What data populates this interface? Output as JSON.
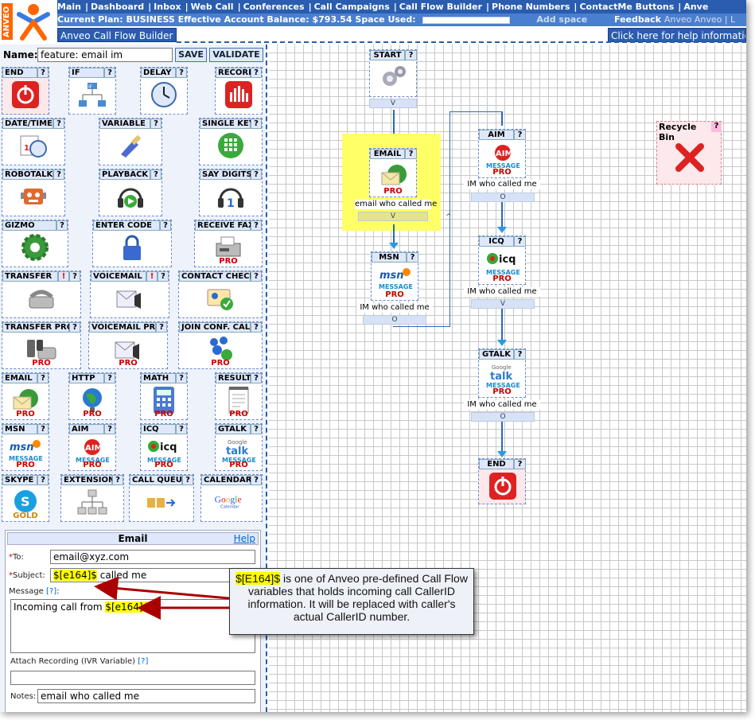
{
  "app": {
    "title": "Anveo Call Flow Builder",
    "help_link": "Click here for help information"
  },
  "logo": {
    "brand": "ANVEO"
  },
  "nav": {
    "items": [
      "Main",
      "Dashboard",
      "Inbox",
      "Web Call",
      "Conferences",
      "Call Campaigns",
      "Call Flow Builder",
      "Phone Numbers",
      "ContactMe Buttons",
      "Anve"
    ]
  },
  "plan": {
    "text": "Current Plan: BUSINESS Effective Account Balance: $793.54 Space Used:",
    "add_space": "Add space",
    "feedback": "Feedback",
    "feedback_suffix": "Anveo Anveo | L"
  },
  "editor": {
    "name_label": "Name:",
    "name_value": "feature: email im",
    "save_label": "SAVE",
    "validate_label": "VALIDATE"
  },
  "palette": [
    {
      "label": "END",
      "icon": "power-icon",
      "pro": ""
    },
    {
      "label": "IF",
      "icon": "if-tree-icon",
      "pro": ""
    },
    {
      "label": "DELAY",
      "icon": "clock-icon",
      "pro": ""
    },
    {
      "label": "RECORD",
      "icon": "record-icon",
      "pro": ""
    },
    {
      "label": "DATE/TIME",
      "icon": "calendar-clock-icon",
      "pro": ""
    },
    {
      "label": "VARIABLE",
      "icon": "brush-icon",
      "pro": ""
    },
    {
      "label": "SINGLE KEY",
      "icon": "keypad-icon",
      "pro": ""
    },
    {
      "label": "ROBOTALK",
      "icon": "robot-icon",
      "pro": ""
    },
    {
      "label": "PLAYBACK",
      "icon": "play-headphones-icon",
      "pro": ""
    },
    {
      "label": "SAY DIGITS",
      "icon": "digits-headphones-icon",
      "pro": ""
    },
    {
      "label": "GIZMO",
      "icon": "gear-icon",
      "pro": ""
    },
    {
      "label": "ENTER CODE",
      "icon": "lock-icon",
      "pro": ""
    },
    {
      "label": "RECEIVE FAX",
      "icon": "fax-icon",
      "pro": "PRO"
    },
    {
      "label": "TRANSFER",
      "icon": "phone-icon",
      "pro": ""
    },
    {
      "label": "VOICEMAIL",
      "icon": "voicemail-icon",
      "pro": ""
    },
    {
      "label": "CONTACT CHECK",
      "icon": "contact-card-icon",
      "pro": ""
    },
    {
      "label": "TRANSFER PRO",
      "icon": "phones-icon",
      "pro": "PRO"
    },
    {
      "label": "VOICEMAIL PRO",
      "icon": "voicemail-pro-icon",
      "pro": "PRO"
    },
    {
      "label": "JOIN CONF. CALL",
      "icon": "conference-icon",
      "pro": "PRO"
    },
    {
      "label": "EMAIL",
      "icon": "email-globe-icon",
      "pro": "PRO"
    },
    {
      "label": "HTTP",
      "icon": "globe-icon",
      "pro": "PRO"
    },
    {
      "label": "MATH",
      "icon": "calculator-icon",
      "pro": "PRO"
    },
    {
      "label": "RESULT",
      "icon": "notepad-icon",
      "pro": "PRO"
    },
    {
      "label": "MSN",
      "icon": "msn-icon",
      "pro": "PRO",
      "sub": "MESSAGE"
    },
    {
      "label": "AIM",
      "icon": "aim-icon",
      "pro": "PRO",
      "sub": "MESSAGE"
    },
    {
      "label": "ICQ",
      "icon": "icq-icon",
      "pro": "PRO",
      "sub": "MESSAGE"
    },
    {
      "label": "GTALK",
      "icon": "gtalk-icon",
      "pro": "PRO",
      "sub": "MESSAGE"
    },
    {
      "label": "SKYPE",
      "icon": "skype-icon",
      "pro": "GOLD"
    },
    {
      "label": "EXTENSION",
      "icon": "extension-tree-icon",
      "pro": ""
    },
    {
      "label": "CALL QUEUE",
      "icon": "queue-icon",
      "pro": ""
    },
    {
      "label": "CALENDAR",
      "icon": "google-calendar-icon",
      "pro": ""
    }
  ],
  "email_panel": {
    "title": "Email",
    "help": "Help",
    "to_label": "To:",
    "to_value": "email@xyz.com",
    "subject_label": "Subject:",
    "subject_var": "$[e164]$",
    "subject_rest": " called me",
    "message_label": "Message",
    "message_help": "[?]",
    "message_prefix": "Incoming call from ",
    "message_var": "$[e164]$",
    "attach_label": "Attach Recording (IVR Variable)",
    "attach_help": "[?]",
    "notes_label": "Notes:",
    "notes_value": "email who called me"
  },
  "flow": {
    "start": {
      "label": "START"
    },
    "email": {
      "label": "EMAIL",
      "note": "email who called me"
    },
    "msn": {
      "label": "MSN",
      "note": "IM who called me"
    },
    "aim": {
      "label": "AIM",
      "note": "IM who called me"
    },
    "icq": {
      "label": "ICQ",
      "note": "IM who called me"
    },
    "gtalk": {
      "label": "GTALK",
      "note": "IM who called me"
    },
    "end": {
      "label": "END"
    },
    "recycle_bin": "Recycle Bin",
    "port_v": "V",
    "port_o": "O",
    "port_loop": "^"
  },
  "callout": {
    "var": "$[E164]$",
    "text": " is one of Anveo pre-defined Call Flow variables that holds incoming call CallerID information. It will be replaced with caller's actual CallerID number."
  },
  "colors": {
    "nav_blue": "#2a5db0",
    "accent_yellow": "#ffff66",
    "pro_red": "#cc0000"
  }
}
